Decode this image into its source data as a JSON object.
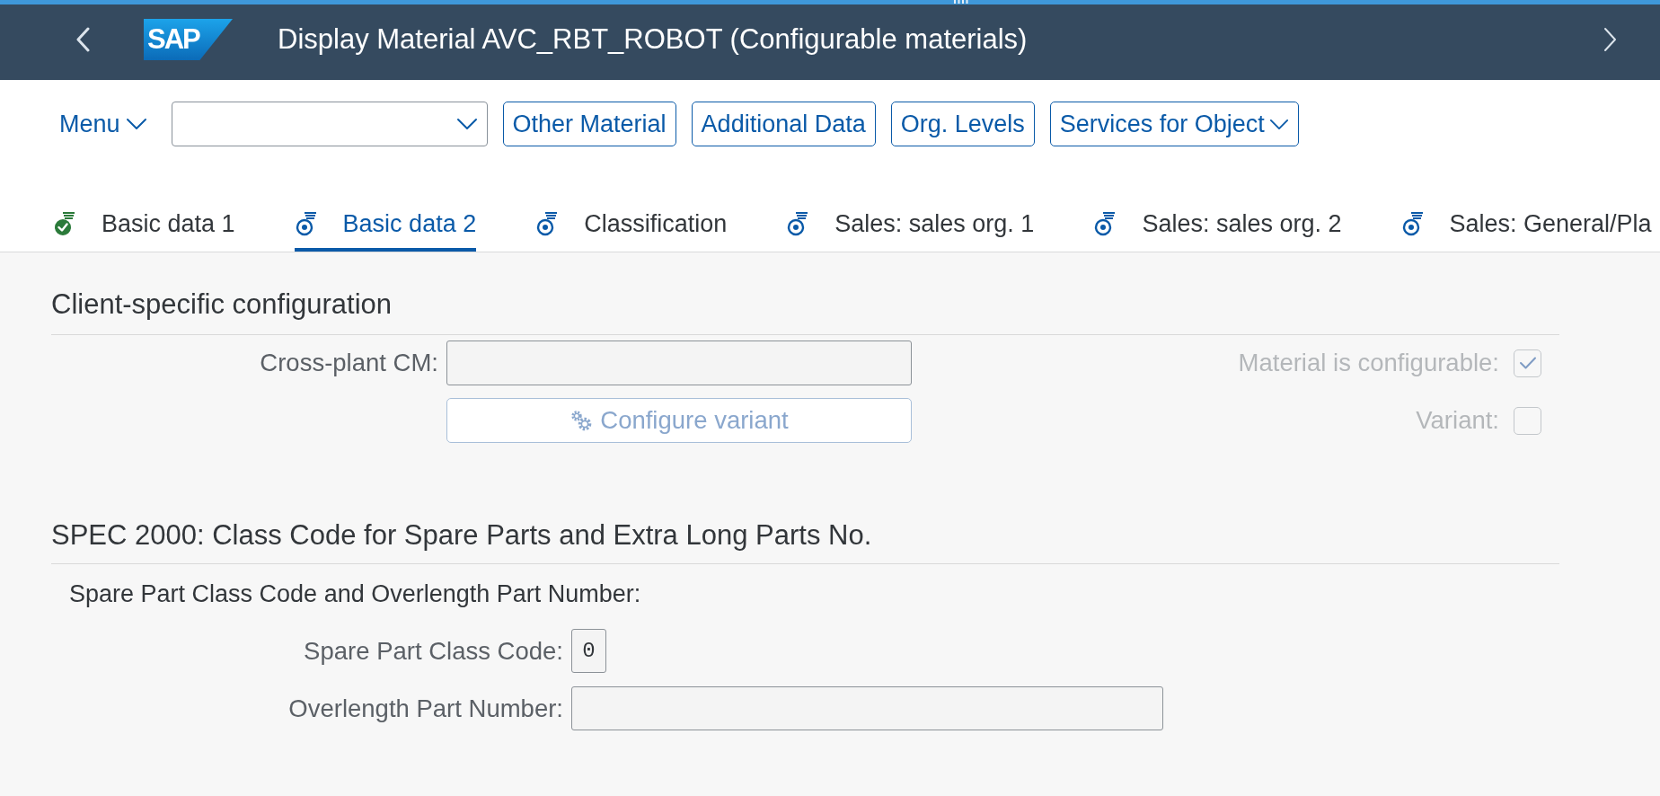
{
  "shell": {
    "logo": "SAP",
    "title": "Display Material AVC_RBT_ROBOT (Configurable materials)"
  },
  "toolbar": {
    "menu": "Menu",
    "buttons": [
      {
        "label": "Other Material",
        "menu": false
      },
      {
        "label": "Additional Data",
        "menu": false
      },
      {
        "label": "Org. Levels",
        "menu": false
      },
      {
        "label": "Services for Object",
        "menu": true
      }
    ]
  },
  "tabs": [
    {
      "label": "Basic data 1",
      "selected": false,
      "checked": true
    },
    {
      "label": "Basic data 2",
      "selected": true,
      "checked": false
    },
    {
      "label": "Classification",
      "selected": false,
      "checked": false
    },
    {
      "label": "Sales: sales org. 1",
      "selected": false,
      "checked": false
    },
    {
      "label": "Sales: sales org. 2",
      "selected": false,
      "checked": false
    },
    {
      "label": "Sales: General/Pla",
      "selected": false,
      "checked": false
    }
  ],
  "sections": [
    {
      "title": "Client-specific configuration",
      "rows": [
        {
          "field": {
            "kind": "input",
            "label": "Cross-plant CM:"
          },
          "aside": {
            "kind": "checkbox",
            "label": "Material is configurable:",
            "checked": true,
            "disabled": true
          }
        },
        {
          "field": {
            "kind": "button",
            "label": "Configure variant",
            "disabled": true
          },
          "aside": {
            "kind": "checkbox",
            "label": "Variant:",
            "checked": false,
            "disabled": true
          }
        }
      ]
    },
    {
      "title": "SPEC 2000: Class Code for Spare Parts and Extra Long Parts No.",
      "subtitle": "Spare Part Class Code and Overlength Part Number:",
      "rows": [
        {
          "field": {
            "kind": "code",
            "label": "Spare Part Class Code:",
            "value": "0"
          }
        },
        {
          "field": {
            "kind": "input",
            "label": "Overlength Part Number:"
          }
        }
      ]
    }
  ]
}
